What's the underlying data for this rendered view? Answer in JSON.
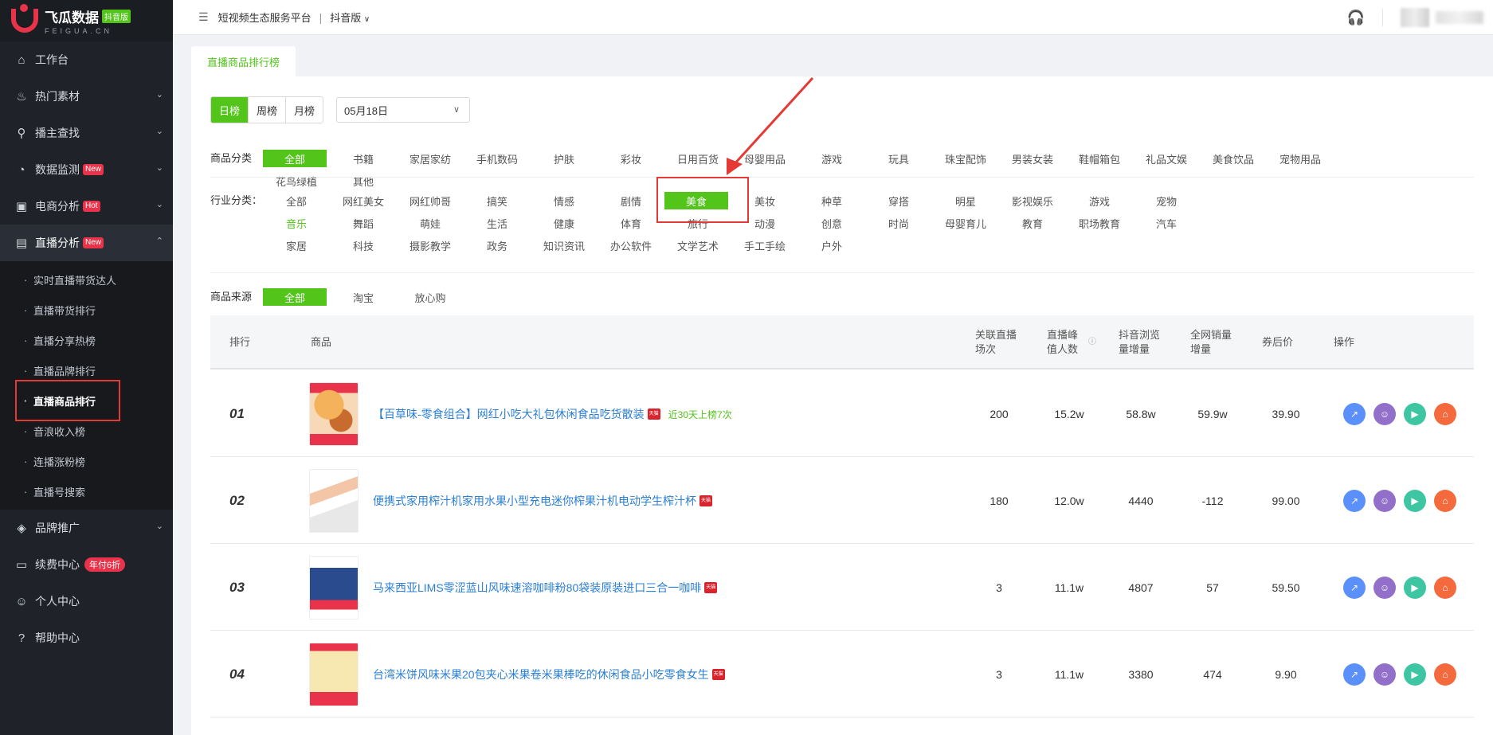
{
  "brand": {
    "name": "飞瓜数据",
    "badge": "抖音版",
    "sub": "FEIGUA.CN"
  },
  "topbar": {
    "platform": "短视频生态服务平台",
    "separator": "|",
    "version": "抖音版"
  },
  "sidebar": {
    "items": [
      {
        "label": "工作台",
        "icon": "home-icon"
      },
      {
        "label": "热门素材",
        "icon": "fire-icon"
      },
      {
        "label": "播主查找",
        "icon": "search-icon"
      },
      {
        "label": "数据监测",
        "icon": "monitor-icon",
        "badge": "New"
      },
      {
        "label": "电商分析",
        "icon": "bag-icon",
        "badge": "Hot"
      },
      {
        "label": "直播分析",
        "icon": "live-icon",
        "badge": "New"
      }
    ],
    "sub_items": [
      "实时直播带货达人",
      "直播带货排行",
      "直播分享热榜",
      "直播品牌排行",
      "直播商品排行",
      "音浪收入榜",
      "连播涨粉榜",
      "直播号搜索"
    ],
    "bottom_items": [
      {
        "label": "品牌推广",
        "icon": "diamond-icon"
      },
      {
        "label": "续费中心",
        "icon": "card-icon",
        "badge": "年付6折"
      },
      {
        "label": "个人中心",
        "icon": "person-icon"
      },
      {
        "label": "帮助中心",
        "icon": "help-icon"
      }
    ]
  },
  "tab": {
    "label": "直播商品排行榜"
  },
  "period": {
    "options": [
      "日榜",
      "周榜",
      "月榜"
    ],
    "selected": "日榜",
    "date": "05月18日"
  },
  "filters": {
    "category_label": "商品分类",
    "categories": [
      "全部",
      "书籍",
      "家居家纺",
      "手机数码",
      "护肤",
      "彩妆",
      "日用百货",
      "母婴用品",
      "游戏",
      "玩具",
      "珠宝配饰",
      "男装女装",
      "鞋帽箱包",
      "礼品文娱",
      "美食饮品",
      "宠物用品",
      "花鸟绿植",
      "其他"
    ],
    "industry_label": "行业分类：",
    "industries": [
      "全部",
      "网红美女",
      "网红帅哥",
      "搞笑",
      "情感",
      "剧情",
      "美食",
      "美妆",
      "种草",
      "穿搭",
      "明星",
      "影视娱乐",
      "游戏",
      "宠物",
      "音乐",
      "舞蹈",
      "萌娃",
      "生活",
      "健康",
      "体育",
      "旅行",
      "动漫",
      "创意",
      "时尚",
      "母婴育儿",
      "教育",
      "职场教育",
      "汽车",
      "家居",
      "科技",
      "摄影教学",
      "政务",
      "知识资讯",
      "办公软件",
      "文学艺术",
      "手工手绘",
      "户外"
    ],
    "source_label": "商品来源",
    "sources": [
      "全部",
      "淘宝",
      "放心购"
    ]
  },
  "table": {
    "headers": {
      "rank": "排行",
      "product": "商品",
      "live_sessions": "关联直播场次",
      "peak_viewers": "直播峰值人数",
      "views": "抖音浏览量增量",
      "sales": "全网销量增量",
      "price": "券后价",
      "actions": "操作"
    },
    "rows": [
      {
        "rank": "01",
        "name": "【百草味-零食组合】网红小吃大礼包休闲食品吃货散装",
        "note": "近30天上榜7次",
        "live_sessions": "200",
        "peak_viewers": "15.2w",
        "views": "58.8w",
        "sales": "59.9w",
        "price": "39.90"
      },
      {
        "rank": "02",
        "name": "便携式家用榨汁机家用水果小型充电迷你榨果汁机电动学生榨汁杯",
        "note": "",
        "live_sessions": "180",
        "peak_viewers": "12.0w",
        "views": "4440",
        "sales": "-112",
        "price": "99.00"
      },
      {
        "rank": "03",
        "name": "马来西亚LIMS零涩蓝山风味速溶咖啡粉80袋装原装进口三合一咖啡",
        "note": "",
        "live_sessions": "3",
        "peak_viewers": "11.1w",
        "views": "4807",
        "sales": "57",
        "price": "59.50"
      },
      {
        "rank": "04",
        "name": "台湾米饼风味米果20包夹心米果卷米果棒吃的休闲食品小吃零食女生",
        "note": "",
        "live_sessions": "3",
        "peak_viewers": "11.1w",
        "views": "3380",
        "sales": "474",
        "price": "9.90"
      }
    ],
    "tmall_tag": "天猫"
  },
  "colors": {
    "accent": "#52c41a",
    "highlight": "#e53935",
    "link": "#2b7fd4",
    "sidebar": "#1f2329"
  }
}
